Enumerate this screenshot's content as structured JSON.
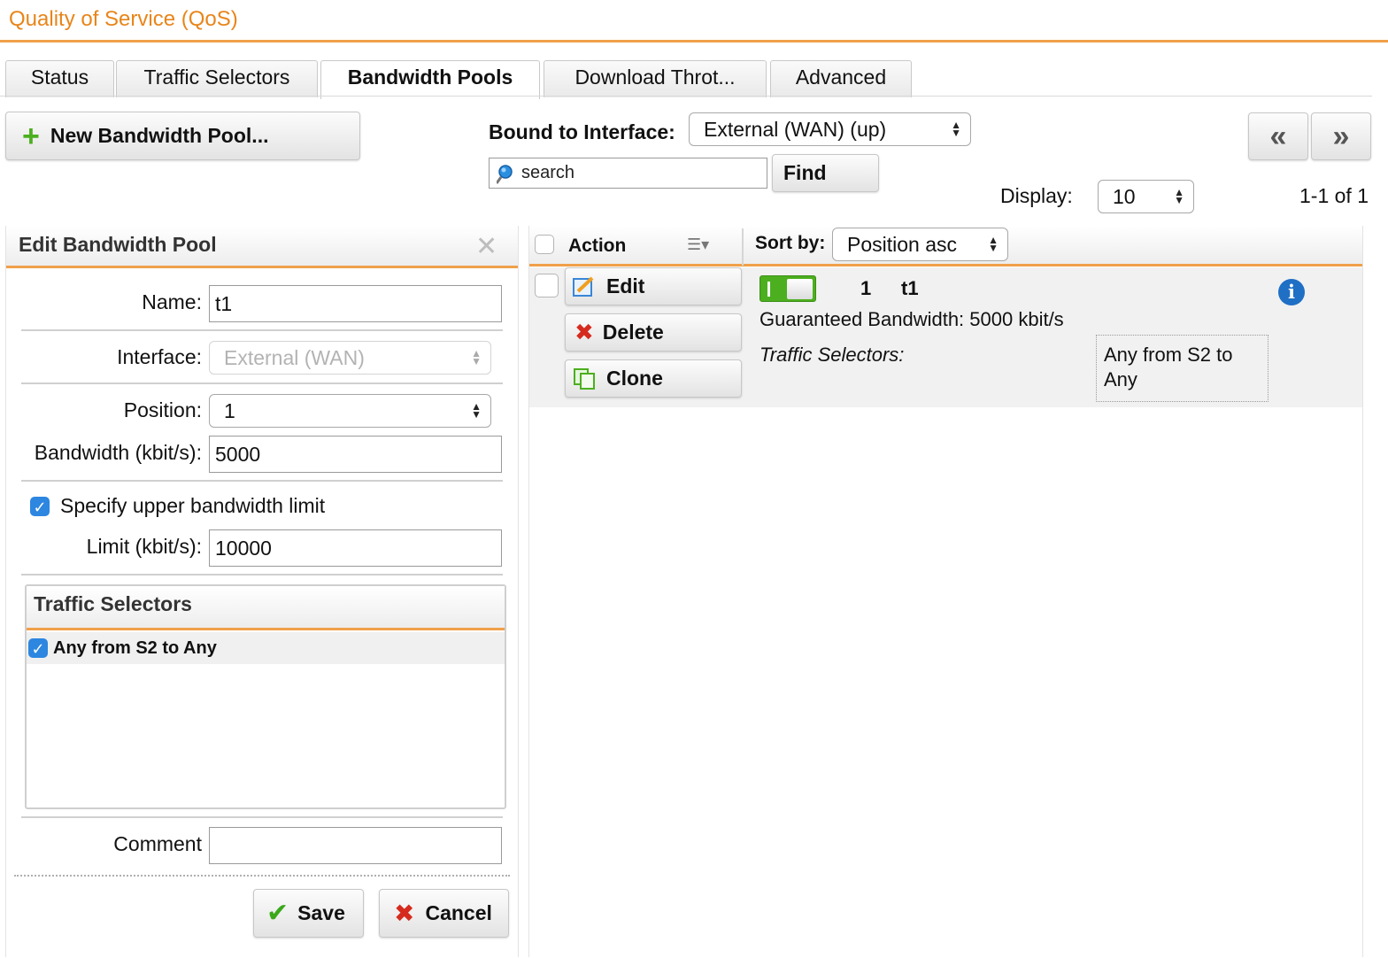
{
  "header": {
    "title": "Quality of Service (QoS)"
  },
  "tabs": [
    {
      "label": "Status",
      "active": false
    },
    {
      "label": "Traffic Selectors",
      "active": false
    },
    {
      "label": "Bandwidth Pools",
      "active": true
    },
    {
      "label": "Download Throt...",
      "active": false
    },
    {
      "label": "Advanced",
      "active": false
    }
  ],
  "toolbar": {
    "new_button": "New Bandwidth Pool...",
    "bound_label": "Bound to Interface:",
    "bound_value": "External (WAN) (up)",
    "search_placeholder": "search",
    "find_button": "Find",
    "prev_label": "«",
    "next_label": "»",
    "display_label": "Display:",
    "display_value": "10",
    "range_text": "1-1 of 1"
  },
  "edit_panel": {
    "title": "Edit Bandwidth Pool",
    "name_label": "Name:",
    "name_value": "t1",
    "interface_label": "Interface:",
    "interface_value": "External (WAN)",
    "position_label": "Position:",
    "position_value": "1",
    "bandwidth_label": "Bandwidth (kbit/s):",
    "bandwidth_value": "5000",
    "upper_limit_label": "Specify upper bandwidth limit",
    "upper_limit_checked": true,
    "limit_label": "Limit (kbit/s):",
    "limit_value": "10000",
    "traffic_selectors_title": "Traffic Selectors",
    "traffic_selectors": [
      {
        "label": "Any from S2 to Any",
        "checked": true
      }
    ],
    "comment_label": "Comment",
    "comment_value": "",
    "save_button": "Save",
    "cancel_button": "Cancel"
  },
  "list": {
    "action_header": "Action",
    "sort_label": "Sort by:",
    "sort_value": "Position asc",
    "items": [
      {
        "edit": "Edit",
        "delete": "Delete",
        "clone": "Clone",
        "enabled": true,
        "position": "1",
        "name": "t1",
        "guaranteed": "Guaranteed Bandwidth: 5000 kbit/s",
        "selectors_label": "Traffic Selectors:",
        "selectors_value": "Any from S2 to Any"
      }
    ]
  },
  "colors": {
    "accent": "#e8851a",
    "info": "#1f6fc5",
    "toggle": "#4caf1f"
  }
}
